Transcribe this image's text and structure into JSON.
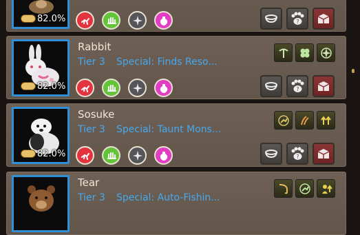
{
  "pets": [
    {
      "name": "",
      "tier": "",
      "special": "",
      "food_percent": "82.0%",
      "skill_icons": []
    },
    {
      "name": "Rabbit",
      "tier": "Tier 3",
      "special": "Special: Finds Reso...",
      "food_percent": "82.0%",
      "skill_icons": [
        "pickaxe-icon",
        "clover-icon",
        "compass-icon"
      ]
    },
    {
      "name": "Sosuke",
      "tier": "Tier 3",
      "special": "Special: Taunt Mons...",
      "food_percent": "82.0%",
      "skill_icons": [
        "sprint-icon",
        "claw-icon",
        "arrows-up-icon"
      ]
    },
    {
      "name": "Tear",
      "tier": "Tier 3",
      "special": "Special: Auto-Fishin...",
      "food_percent": "",
      "skill_icons": [
        "fishing-icon",
        "sprint-icon",
        "buff-icon"
      ]
    }
  ],
  "stat_icons": [
    "running-icon",
    "hand-icon",
    "compass-star-icon",
    "potion-icon"
  ],
  "buttons": [
    "feed-bowl-icon",
    "paw-question-icon",
    "return-box-icon"
  ],
  "colors": {
    "card_bg": "#6a5c50",
    "portrait_border": "#2f8fd8",
    "tier_text": "#46a8ef",
    "stat_red": "#e2333f",
    "stat_green": "#63c43a",
    "stat_grey": "#55565a",
    "stat_pink": "#e23dc3"
  }
}
